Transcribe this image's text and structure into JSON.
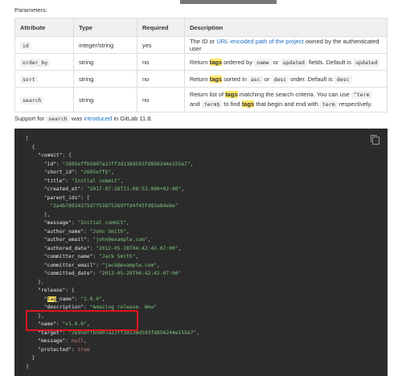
{
  "params_label": "Parameters:",
  "table": {
    "headers": [
      "Attribute",
      "Type",
      "Required",
      "Description"
    ],
    "rows": [
      {
        "attr": "id",
        "type": "integer/string",
        "req": "yes",
        "desc_pre": "The ID or ",
        "desc_link": "URL-encoded path of the project",
        "desc_post": " owned by the authenticated user"
      },
      {
        "attr": "order_by",
        "type": "string",
        "req": "no",
        "d1": "Return ",
        "d2": "tags",
        "d3": " ordered by ",
        "c1": "name",
        "d4": " or ",
        "c2": "updated",
        "d5": " fields. Default is ",
        "c3": "updated"
      },
      {
        "attr": "sort",
        "type": "string",
        "req": "no",
        "d1": "Return ",
        "d2": "tags",
        "d3": " sorted in ",
        "c1": "asc",
        "d4": " or ",
        "c2": "desc",
        "d5": " order. Default is ",
        "c3": "desc"
      },
      {
        "attr": "search",
        "type": "string",
        "req": "no",
        "d1": "Return list of ",
        "d2": "tags",
        "d3": " matching the search criteria. You can use ",
        "c1": "^term",
        "d4": " and ",
        "c2": "term$",
        "d5": " to find ",
        "d6": "tags",
        "d7": " that begin and end with ",
        "c3": "term",
        "d8": " respectively."
      }
    ]
  },
  "support": {
    "pre": "Support for ",
    "code": "search",
    "mid": " was ",
    "link": "introduced",
    "post": " in GitLab 11.8."
  },
  "code_lines": [
    "[",
    "  {",
    "    \"commit\": {",
    "      \"id\": \"2695effb5807a22ff3d138d593fd856244e155e7\",",
    "      \"short_id\": \"2695effb\",",
    "      \"title\": \"Initial commit\",",
    "      \"created_at\": \"2017-07-26T11:08:53.000+02:00\",",
    "      \"parent_ids\": [",
    "        \"2a4b78934375d7f53875269ffd4f45fd83a84ebe\"",
    "      ],",
    "      \"message\": \"Initial commit\",",
    "      \"author_name\": \"John Smith\",",
    "      \"author_email\": \"john@example.com\",",
    "      \"authored_date\": \"2012-05-28T04:42:42-07:00\",",
    "      \"committer_name\": \"Jack Smith\",",
    "      \"committer_email\": \"jack@example.com\",",
    "      \"committed_date\": \"2012-05-28T04:42:42-07:00\"",
    "    },",
    "    \"release\": {",
    "      \"tag_name\": \"1.0.0\",",
    "      \"description\": \"Amazing release. Wow\"",
    "    },",
    "    \"name\": \"v1.0.0\",",
    "    \"target\": \"2695effb5807a22ff3d138d593fd856244e155e7\",",
    "    \"message\": null,",
    "    \"protected\": true",
    "  }",
    "]"
  ]
}
